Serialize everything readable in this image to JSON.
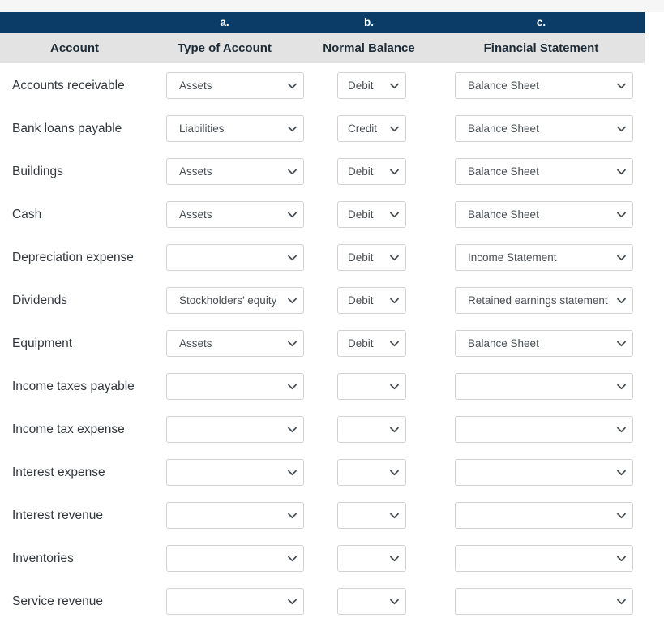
{
  "header": {
    "letters": [
      "",
      "a.",
      "b.",
      "c."
    ],
    "columns": [
      "Account",
      "Type of Account",
      "Normal Balance",
      "Financial Statement"
    ]
  },
  "icons": {
    "chevron": "chevron-down-icon"
  },
  "colors": {
    "navy": "#0b3c68",
    "header_gray": "#e3e3e3",
    "text": "#32373c",
    "select_border": "#d2d2d2",
    "select_text": "#4a4f54",
    "top_strip": "#f6f6f6"
  },
  "rows": [
    {
      "account": "Accounts receivable",
      "type": "Assets",
      "balance": "Debit",
      "statement": "Balance Sheet"
    },
    {
      "account": "Bank loans payable",
      "type": "Liabilities",
      "balance": "Credit",
      "statement": "Balance Sheet"
    },
    {
      "account": "Buildings",
      "type": "Assets",
      "balance": "Debit",
      "statement": "Balance Sheet"
    },
    {
      "account": "Cash",
      "type": "Assets",
      "balance": "Debit",
      "statement": "Balance Sheet"
    },
    {
      "account": "Depreciation expense",
      "type": "",
      "balance": "Debit",
      "statement": "Income Statement"
    },
    {
      "account": "Dividends",
      "type": "Stockholders’ equity",
      "balance": "Debit",
      "statement": "Retained earnings statement"
    },
    {
      "account": "Equipment",
      "type": "Assets",
      "balance": "Debit",
      "statement": "Balance Sheet"
    },
    {
      "account": "Income taxes payable",
      "type": "",
      "balance": "",
      "statement": ""
    },
    {
      "account": "Income tax expense",
      "type": "",
      "balance": "",
      "statement": ""
    },
    {
      "account": "Interest expense",
      "type": "",
      "balance": "",
      "statement": ""
    },
    {
      "account": "Interest revenue",
      "type": "",
      "balance": "",
      "statement": ""
    },
    {
      "account": "Inventories",
      "type": "",
      "balance": "",
      "statement": ""
    },
    {
      "account": "Service revenue",
      "type": "",
      "balance": "",
      "statement": ""
    }
  ]
}
